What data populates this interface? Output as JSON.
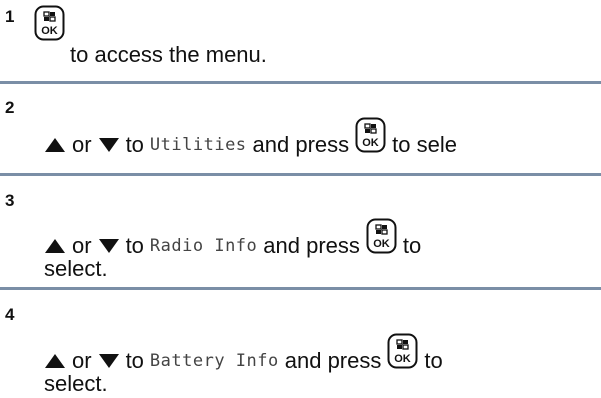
{
  "steps": [
    {
      "number": "1",
      "text_after_key": "to access the menu."
    },
    {
      "number": "2",
      "or": "or",
      "to": "to",
      "item": "Utilities",
      "and_press": "and press",
      "trailing": "to sele"
    },
    {
      "number": "3",
      "or": "or",
      "to": "to",
      "item": "Radio Info",
      "and_press": "and press",
      "trailing": "to",
      "continuation": "select."
    },
    {
      "number": "4",
      "or": "or",
      "to": "to",
      "item": "Battery Info",
      "and_press": "and press",
      "trailing": "to",
      "continuation": "select."
    }
  ],
  "ok_key_label": "OK",
  "colors": {
    "divider": "#7a8ea6",
    "text": "#111111"
  },
  "icons": [
    "up-arrow-icon",
    "down-arrow-icon",
    "ok-menu-key-icon"
  ]
}
